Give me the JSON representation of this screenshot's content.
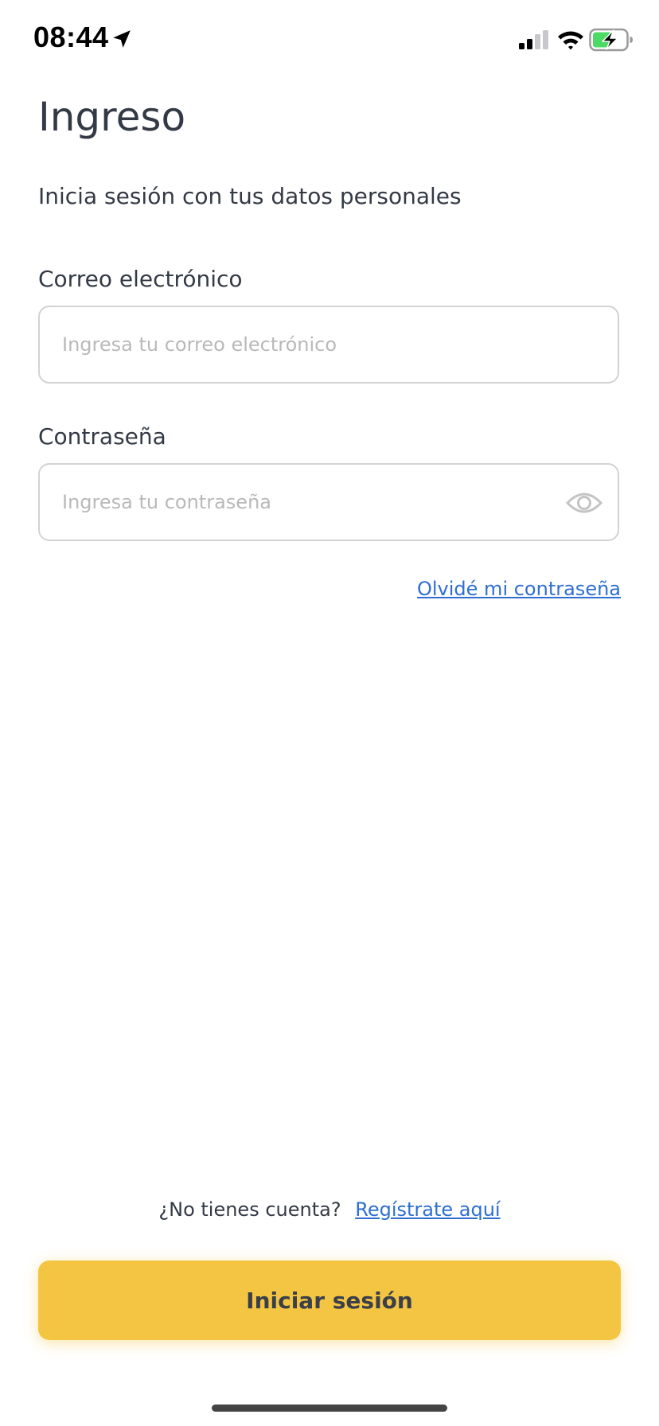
{
  "status_bar": {
    "time": "08:44",
    "icons": [
      "location-arrow-icon",
      "cellular-signal-icon",
      "wifi-icon",
      "battery-charging-icon"
    ],
    "battery_color": "#4cd964"
  },
  "page": {
    "title": "Ingreso",
    "subtitle": "Inicia sesión con tus datos personales"
  },
  "form": {
    "email": {
      "label": "Correo electrónico",
      "value": "",
      "placeholder": "Ingresa tu correo electrónico"
    },
    "password": {
      "label": "Contraseña",
      "value": "",
      "placeholder": "Ingresa tu contraseña",
      "toggle_icon": "eye-icon"
    },
    "forgot_link": "Olvidé mi contraseña"
  },
  "footer": {
    "register_prompt": "¿No tienes cuenta?",
    "register_link": "Regístrate aquí",
    "login_button": "Iniciar sesión"
  },
  "colors": {
    "accent": "#f4c542",
    "link": "#2f6fd1",
    "text": "#333a46",
    "border": "#d3d3d3",
    "placeholder": "#b9b9b9"
  }
}
